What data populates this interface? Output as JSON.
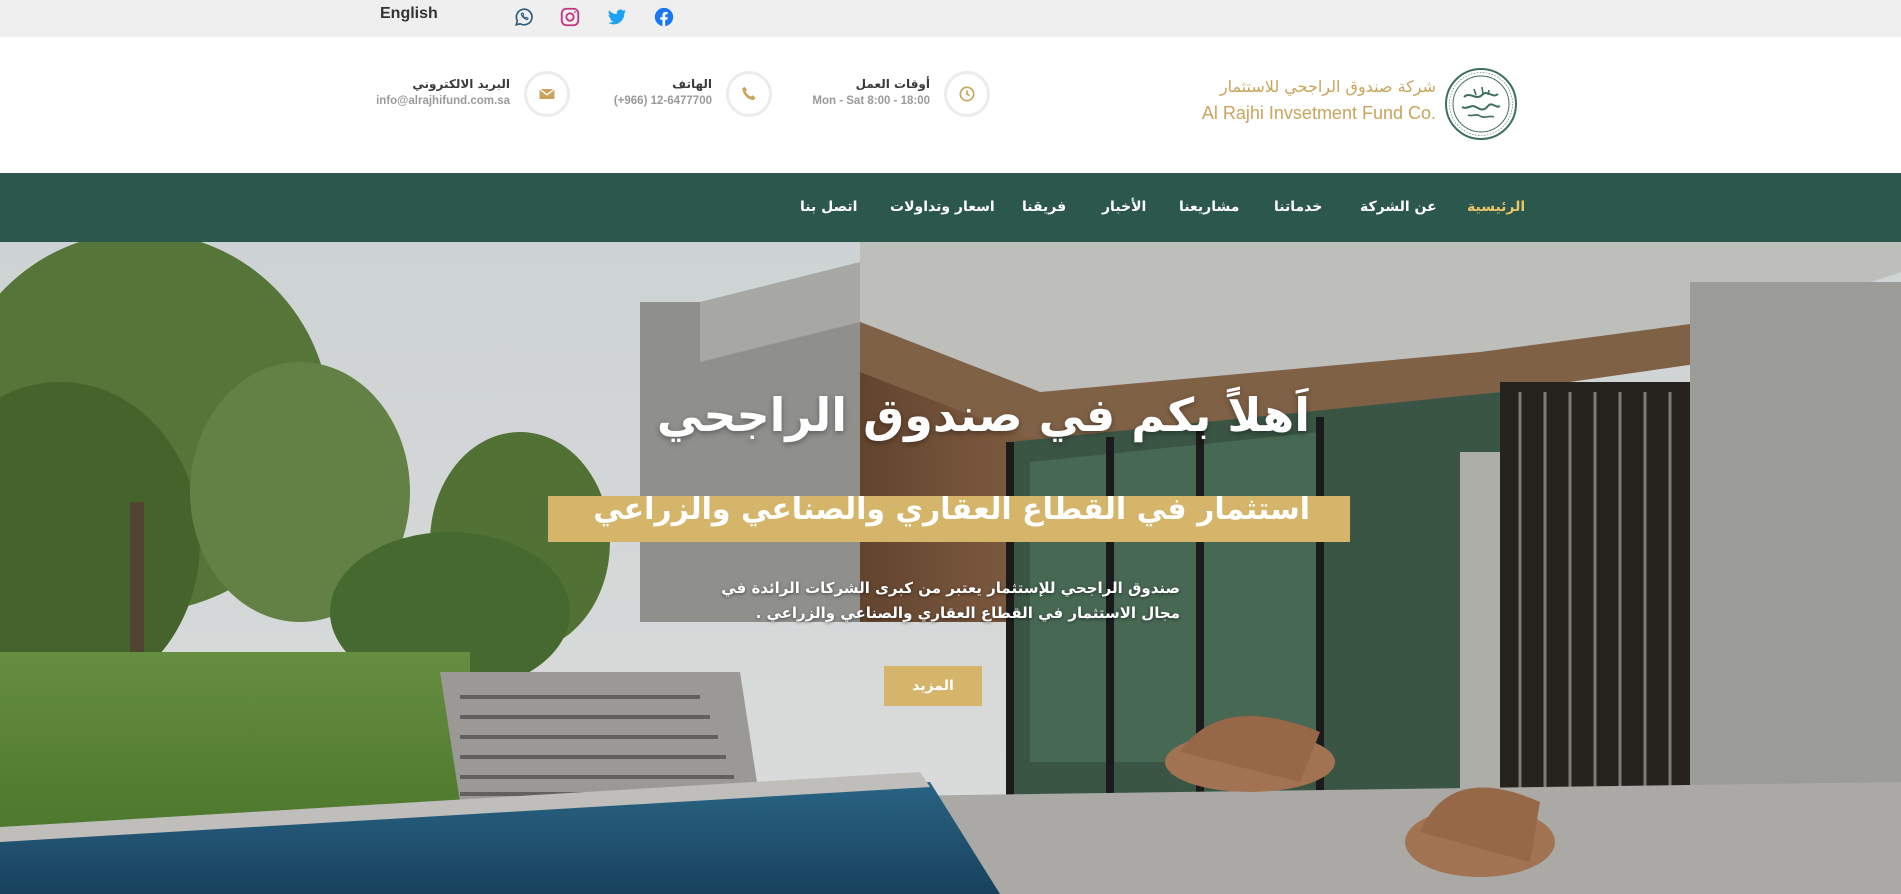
{
  "topbar": {
    "language_link": "English",
    "social": [
      {
        "icon": "whatsapp-icon"
      },
      {
        "icon": "instagram-icon"
      },
      {
        "icon": "twitter-icon"
      },
      {
        "icon": "facebook-icon"
      }
    ]
  },
  "header": {
    "logo": {
      "arabic_name": "شركة صندوق الراجحي للاستثمار",
      "english_name": "Al Rajhi Invsetment Fund Co."
    },
    "info": [
      {
        "icon": "clock-icon",
        "label": "أوقات العمل",
        "value": "Mon - Sat 8:00 - 18:00"
      },
      {
        "icon": "phone-icon",
        "label": "الهاتف",
        "value": "(+966) 12-6477700"
      },
      {
        "icon": "envelope-icon",
        "label": "البريد الالكتروني",
        "value": "info@alrajhifund.com.sa"
      }
    ]
  },
  "nav": {
    "items": [
      {
        "label": "الرئيسية",
        "active": true
      },
      {
        "label": "عن الشركة"
      },
      {
        "label": "خدماتنا"
      },
      {
        "label": "مشاريعنا"
      },
      {
        "label": "الأخبار"
      },
      {
        "label": "فريقنا"
      },
      {
        "label": "اسعار وتداولات"
      },
      {
        "label": "اتصل بنا"
      }
    ]
  },
  "hero": {
    "title": "اَهلاً بكم في صندوق الراجحي",
    "subtitle": "استثمار في القطاع العقاري والصناعي والزراعي",
    "description": "صندوق الراجحي للإستثمار يعتبر من كبرى الشركات الرائدة في مجال الاستثمار في القطاع العقاري والصناعي والزراعي .",
    "button_label": "المزيد"
  },
  "colors": {
    "nav_background": "#2b574c",
    "accent_gold": "#d4b56a",
    "active_nav": "#e9c46a",
    "topbar_background": "#efefef"
  }
}
